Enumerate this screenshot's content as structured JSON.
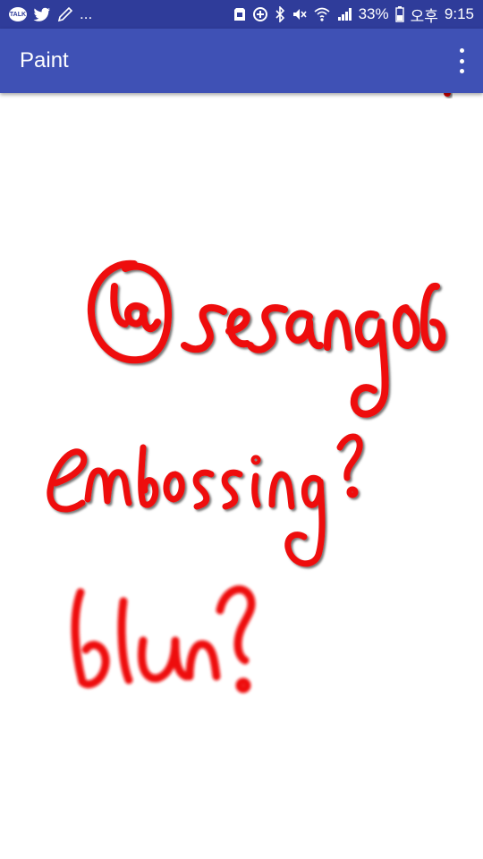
{
  "status_bar": {
    "notification_icons": [
      "kakaotalk-icon",
      "twitter-icon",
      "pencil-icon"
    ],
    "talk_badge": "TALK",
    "more": "...",
    "battery_percent": "33%",
    "ampm": "오후",
    "time": "9:15",
    "system_icons": [
      "sd-card-icon",
      "sync-icon",
      "bluetooth-icon",
      "mute-icon",
      "wifi-icon",
      "signal-icon",
      "battery-icon"
    ]
  },
  "app_bar": {
    "title": "Paint",
    "menu_icon": "overflow-menu-icon",
    "color": "#3f51b5"
  },
  "canvas": {
    "stroke_color": "#ee1111",
    "handwritten_texts": [
      "@sesang06",
      "embossing?",
      "blur?"
    ]
  }
}
